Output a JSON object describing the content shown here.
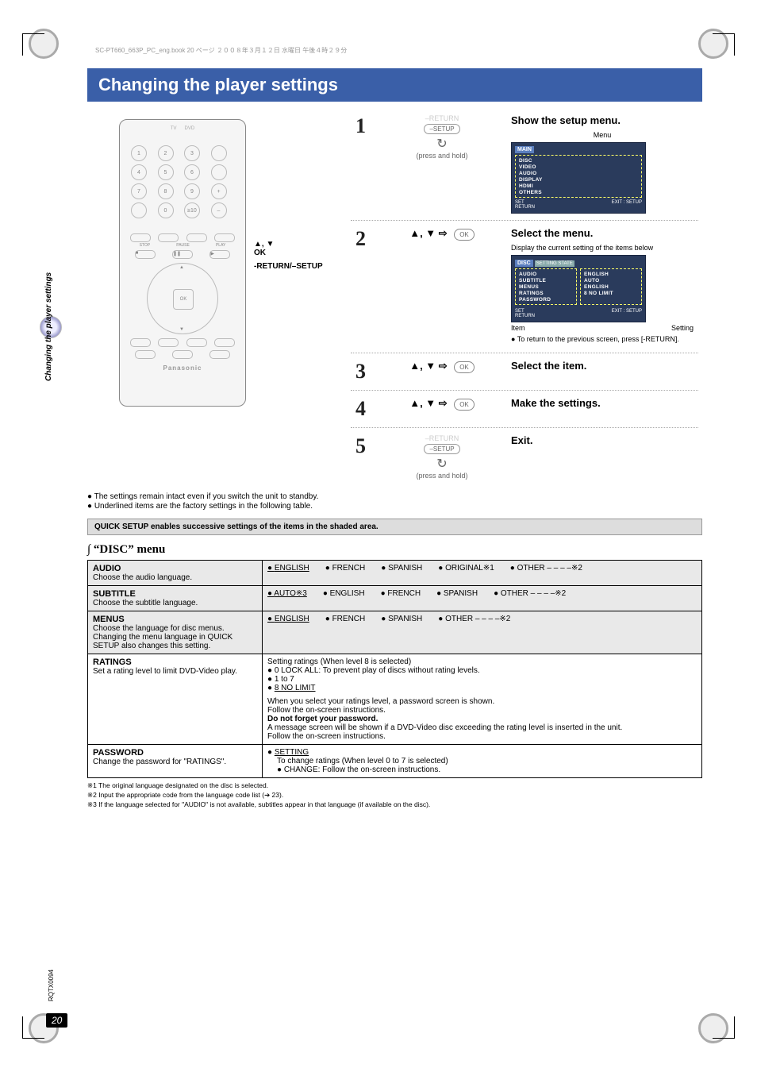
{
  "header_info": "SC-PT660_663P_PC_eng.book  20 ページ  ２００８年３月１２日 水曜日 午後４時２９分",
  "title": "Changing the player settings",
  "side_tab": "Changing the player settings",
  "rqtx": "RQTX0094",
  "page_number": "20",
  "remote": {
    "brand": "Panasonic",
    "ok": "OK",
    "callouts": {
      "nav": "▲, ▼\nOK",
      "return": "-RETURN/–SETUP"
    },
    "transport": {
      "stop": "STOP",
      "pause": "PAUSE",
      "play": "PLAY"
    }
  },
  "steps": [
    {
      "num": "1",
      "ctrl_lines": [
        "–RETURN",
        "–SETUP"
      ],
      "ctrl_sub": "(press and hold)",
      "title": "Show the setup menu.",
      "menu_label": "Menu",
      "osd": {
        "title": "MAIN",
        "items": [
          "DISC",
          "VIDEO",
          "AUDIO",
          "DISPLAY",
          "HDMI",
          "OTHERS"
        ],
        "footer_left": "SET\nRETURN",
        "footer_right": "EXIT : SETUP"
      }
    },
    {
      "num": "2",
      "ctrl_lines": [
        "▲, ▼ ⇨"
      ],
      "ctrl_ok": "OK",
      "title": "Select the menu.",
      "sub": "Display the current setting of the items below",
      "osd": {
        "title": "DISC",
        "heading": "SETTING STATE",
        "left": [
          "AUDIO",
          "SUBTITLE",
          "MENUS",
          "RATINGS",
          "PASSWORD"
        ],
        "right": [
          "ENGLISH",
          "AUTO",
          "ENGLISH",
          "8 NO LIMIT",
          ""
        ],
        "footer_left": "SET\nRETURN",
        "footer_right": "EXIT : SETUP"
      },
      "item_label": "Item",
      "setting_label": "Setting",
      "bullet": "To return to the previous screen, press [-RETURN]."
    },
    {
      "num": "3",
      "ctrl_lines": [
        "▲, ▼ ⇨"
      ],
      "ctrl_ok": "OK",
      "title": "Select the item."
    },
    {
      "num": "4",
      "ctrl_lines": [
        "▲, ▼ ⇨"
      ],
      "ctrl_ok": "OK",
      "title": "Make the settings."
    },
    {
      "num": "5",
      "ctrl_lines": [
        "–RETURN",
        "–SETUP"
      ],
      "ctrl_sub": "(press and hold)",
      "title": "Exit."
    }
  ],
  "notes": [
    "The settings remain intact even if you switch the unit to standby.",
    "Underlined items are the factory settings in the following table."
  ],
  "quick_setup": "QUICK SETUP enables successive settings of the items in the shaded area.",
  "disc_menu_heading": "∫ “DISC” menu",
  "table": {
    "audio": {
      "name": "AUDIO",
      "desc": "Choose the audio language.",
      "opts": [
        "ENGLISH",
        "FRENCH",
        "SPANISH",
        "ORIGINAL※1",
        "OTHER – – – –※2"
      ],
      "default_idx": 0
    },
    "subtitle": {
      "name": "SUBTITLE",
      "desc": "Choose the subtitle language.",
      "opts": [
        "AUTO※3",
        "ENGLISH",
        "FRENCH",
        "SPANISH",
        "OTHER – – – –※2"
      ],
      "default_idx": 0
    },
    "menus": {
      "name": "MENUS",
      "desc": "Choose the language for disc menus. Changing the menu language in QUICK SETUP also changes this setting.",
      "opts": [
        "ENGLISH",
        "FRENCH",
        "SPANISH",
        "OTHER – – – –※2"
      ],
      "default_idx": 0
    },
    "ratings": {
      "name": "RATINGS",
      "desc": "Set a rating level to limit DVD-Video play.",
      "heading": "Setting ratings (When level 8 is selected)",
      "opts": [
        "0 LOCK ALL: To prevent play of discs without rating levels.",
        "1 to 7",
        "8 NO LIMIT"
      ],
      "default_idx": 2,
      "para1": "When you select your ratings level, a password screen is shown.",
      "para2": "Follow the on-screen instructions.",
      "bold": "Do not forget your password.",
      "para3": "A message screen will be shown if a DVD-Video disc exceeding the rating level is inserted in the unit.",
      "para4": "Follow the on-screen instructions."
    },
    "password": {
      "name": "PASSWORD",
      "desc": "Change the password for \"RATINGS\".",
      "opt": "SETTING",
      "line1": "To change ratings (When level 0 to 7 is selected)",
      "line2": "CHANGE: Follow the on-screen instructions."
    }
  },
  "footnotes": [
    "※1 The original language designated on the disc is selected.",
    "※2 Input the appropriate code from the language code list (➔ 23).",
    "※3 If the language selected for \"AUDIO\" is not available, subtitles appear in that language (if available on the disc)."
  ]
}
